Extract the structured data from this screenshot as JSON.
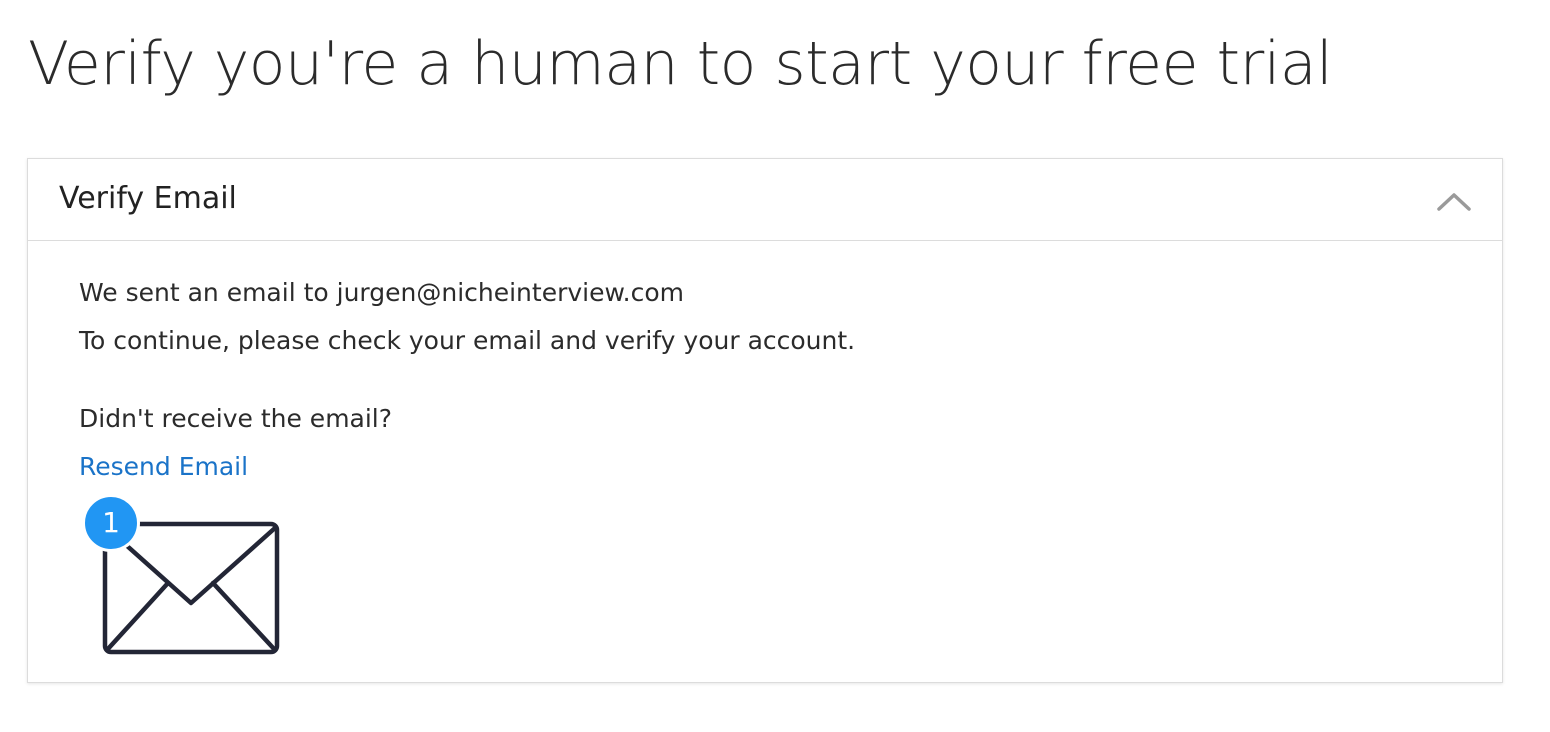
{
  "page": {
    "title": "Verify you're a human to start your free trial"
  },
  "panel": {
    "title": "Verify Email",
    "collapse_icon": "chevron-up-icon",
    "message_line_1": "We sent an email to jurgen@nicheinterview.com",
    "message_line_2": "To continue, please check your email and verify your account.",
    "not_received": "Didn't receive the email?",
    "resend_label": "Resend Email",
    "mail_icon": "envelope-icon",
    "badge_count": "1"
  },
  "colors": {
    "link": "#1a73c8",
    "badge": "#2196f3",
    "border": "#dcdcdc",
    "text": "#2b2b2b"
  }
}
